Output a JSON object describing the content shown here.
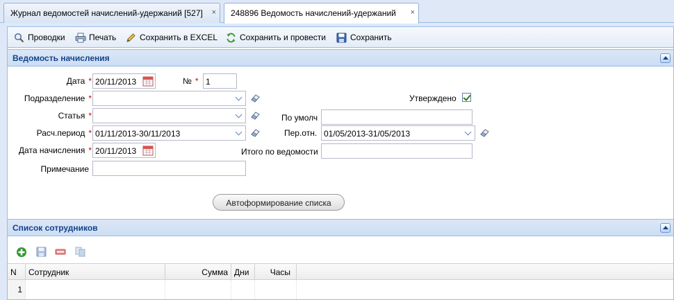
{
  "tabs": [
    {
      "label": "Журнал ведомостей начислений-удержаний [527]",
      "close": "×"
    },
    {
      "label": "248896 Ведомость начислений-удержаний",
      "close": "×"
    }
  ],
  "toolbar": {
    "postings": "Проводки",
    "print": "Печать",
    "save_excel": "Сохранить в EXCEL",
    "save_and_post": "Сохранить и провести",
    "save": "Сохранить"
  },
  "form_section": {
    "title": "Ведомость начисления",
    "date_label": "Дата",
    "date_value": "20/11/2013",
    "number_label": "№",
    "number_value": "1",
    "department_label": "Подразделение",
    "department_value": "",
    "approved_label": "Утверждено",
    "approved": true,
    "article_label": "Статья",
    "article_value": "",
    "default_label": "По умолч",
    "default_value": "",
    "calc_period_label": "Расч.период",
    "calc_period_value": "01/11/2013-30/11/2013",
    "rel_period_label": "Пер.отн.",
    "rel_period_value": "01/05/2013-31/05/2013",
    "accrual_date_label": "Дата начисления",
    "accrual_date_value": "20/11/2013",
    "total_label": "Итого по ведомости",
    "total_value": "",
    "note_label": "Примечание",
    "note_value": "",
    "required_mark": "*",
    "autoform_button": "Автоформирование списка"
  },
  "employees_section": {
    "title": "Список сотрудников",
    "columns": [
      "N",
      "Сотрудник",
      "Сумма",
      "Дни",
      "Часы"
    ],
    "rows": [
      {
        "n": "1",
        "employee": "",
        "sum": "",
        "days": "",
        "hours": ""
      }
    ]
  },
  "colors": {
    "accent": "#15428b",
    "border": "#99bbe8",
    "required": "#cc0000"
  },
  "icons": [
    "search-icon",
    "printer-icon",
    "pencil-icon",
    "refresh-icon",
    "floppy-disk-icon",
    "calendar-icon",
    "eraser-icon",
    "add-icon",
    "delete-icon",
    "copy-icon"
  ]
}
